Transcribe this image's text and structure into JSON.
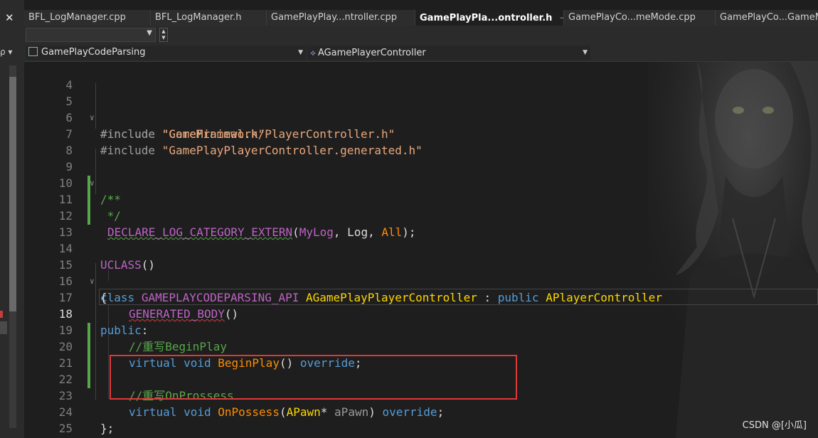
{
  "tabs": [
    {
      "label": "BFL_LogManager.cpp"
    },
    {
      "label": "BFL_LogManager.h"
    },
    {
      "label": "GamePlayPlay...ntroller.cpp"
    },
    {
      "label": "GamePlayPla...ontroller.h",
      "active": true,
      "pin": "⊣",
      "close": "×"
    },
    {
      "label": "GamePlayCo...meMode.cpp"
    },
    {
      "label": "GamePlayCo...GameMo"
    }
  ],
  "nav": {
    "project": "GamePlayCodeParsing",
    "scope": "AGamePlayerController"
  },
  "icons": {
    "close_icon": "✕",
    "search_mini": "ρ ▾",
    "file_icon": "file-icon",
    "class_icon": "class-icon"
  },
  "colors": {
    "comment": "#57a64a",
    "keyword": "#569cd6",
    "type": "#ffd700",
    "function": "#ff8c00",
    "string": "#e8a87c",
    "macro": "#bd63c5",
    "highlight_box": "#e0373a"
  },
  "editor": {
    "current_line": "18",
    "lines": [
      {
        "n": "4"
      },
      {
        "n": "5",
        "include": "#include ",
        "file": "\"CoreMinimal.h\""
      },
      {
        "n": "6",
        "include": "#include ",
        "file": "\"GameFramework/PlayerController.h\""
      },
      {
        "n": "7",
        "include": "#include ",
        "file": "\"GamePlayPlayerController.generated.h\""
      },
      {
        "n": "8"
      },
      {
        "n": "9",
        "text": "/**"
      },
      {
        "n": "10",
        "text": " *"
      },
      {
        "n": "11",
        "text": " */"
      },
      {
        "n": "12",
        "macro": "DECLARE_LOG_CATEGORY_EXTERN",
        "open": "(",
        "a1": "MyLog",
        "sep1": ", ",
        "a2": "Log",
        "sep2": ", ",
        "a3": "All",
        "close": ");"
      },
      {
        "n": "13"
      },
      {
        "n": "14",
        "macro": "UCLASS",
        "rest": "()"
      },
      {
        "n": "15",
        "kw": "class",
        "api": "GAMEPLAYCODEPARSING_API",
        "cls": "AGamePlayPlayerController",
        "colon": " : ",
        "kw2": "public",
        "base": "APlayerController"
      },
      {
        "n": "16",
        "text": "{"
      },
      {
        "n": "17",
        "macro": "GENERATED_BODY",
        "rest": "()"
      },
      {
        "n": "18",
        "kw": "public",
        "rest": ":"
      },
      {
        "n": "19",
        "text": "//重写BeginPlay"
      },
      {
        "n": "20",
        "kw1": "virtual",
        "kw2": "void",
        "fn": "BeginPlay",
        "args": "()",
        "kw3": "override",
        "end": ";"
      },
      {
        "n": "21"
      },
      {
        "n": "22",
        "text": "//重写OnProssess"
      },
      {
        "n": "23",
        "kw1": "virtual",
        "kw2": "void",
        "fn": "OnPossess",
        "open": "(",
        "type": "APawn",
        "star": "*",
        "param": "aPawn",
        "close": ")",
        "kw3": "override",
        "end": ";"
      },
      {
        "n": "24",
        "text": "};"
      },
      {
        "n": "25"
      }
    ]
  },
  "watermark": "CSDN @[小瓜]"
}
